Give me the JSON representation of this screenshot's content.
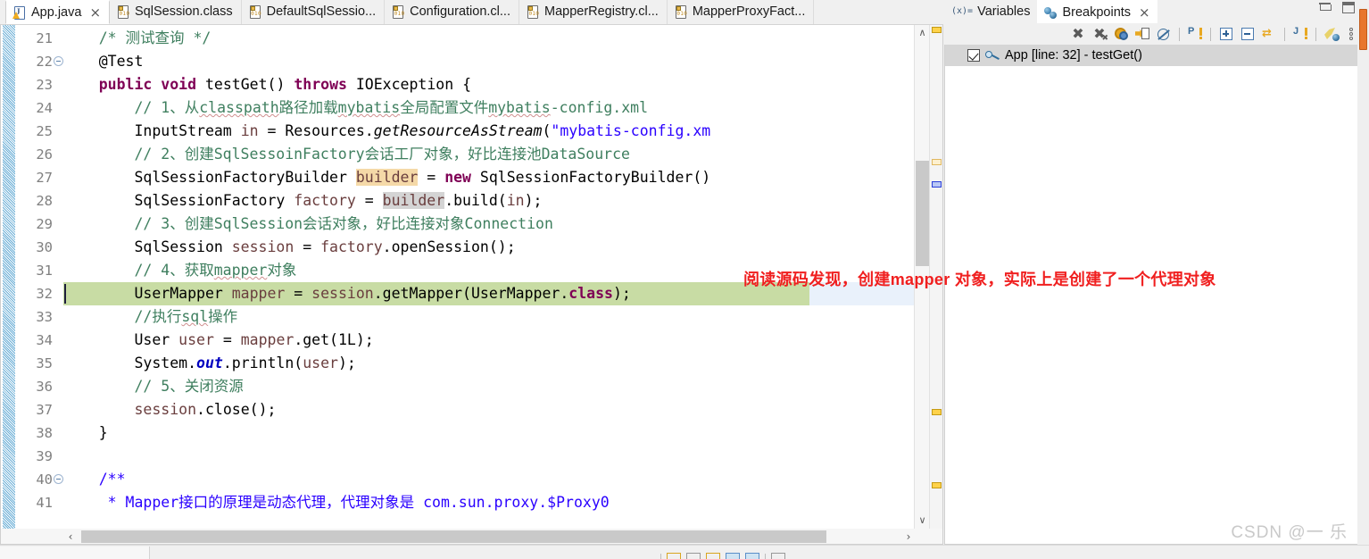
{
  "editor": {
    "tabs": [
      {
        "label": "App.java",
        "icon": "java-file-icon",
        "active": true,
        "closable": true,
        "close_glyph": "×"
      },
      {
        "label": "SqlSession.class",
        "icon": "class-file-icon",
        "active": false,
        "closable": false
      },
      {
        "label": "DefaultSqlSessio...",
        "icon": "class-file-icon",
        "active": false,
        "closable": false
      },
      {
        "label": "Configuration.cl...",
        "icon": "class-file-icon",
        "active": false,
        "closable": false
      },
      {
        "label": "MapperRegistry.cl...",
        "icon": "class-file-icon",
        "active": false,
        "closable": false
      },
      {
        "label": "MapperProxyFact...",
        "icon": "class-file-icon",
        "active": false,
        "closable": false
      }
    ],
    "first_line_number": 21,
    "lines": [
      {
        "n": 21,
        "fold": false,
        "bp": false,
        "html": "<span class=\"cmt\">    /* 测试查询 */</span>"
      },
      {
        "n": 22,
        "fold": true,
        "bp": false,
        "html": "    @Test"
      },
      {
        "n": 23,
        "fold": false,
        "bp": false,
        "html": "    <span class=\"kw\">public</span> <span class=\"kw\">void</span> testGet() <span class=\"kw\">throws</span> IOException {"
      },
      {
        "n": 24,
        "fold": false,
        "bp": false,
        "html": "        <span class=\"cmt\">// 1、从<span class=\"sq\">classpath</span>路径加载<span class=\"sq\">mybatis</span>全局配置文件<span class=\"sq\">mybatis</span>-config.xml</span>"
      },
      {
        "n": 25,
        "fold": false,
        "bp": false,
        "html": "        InputStream <span class=\"lvar\">in</span> = Resources.<span class=\"mth\">getResourceAsStream</span>(<span class=\"str\">\"mybatis-config.xm</span>"
      },
      {
        "n": 26,
        "fold": false,
        "bp": false,
        "html": "        <span class=\"cmt\">// 2、创建SqlSessoinFactory会话工厂对象，好比连接池DataSource</span>"
      },
      {
        "n": 27,
        "fold": false,
        "bp": false,
        "html": "        SqlSessionFactoryBuilder <span class=\"lvar hi-occ-o\">builder</span> = <span class=\"kw\">new</span> SqlSessionFactoryBuilder()"
      },
      {
        "n": 28,
        "fold": false,
        "bp": false,
        "html": "        SqlSessionFactory <span class=\"lvar\">factory</span> = <span class=\"lvar hi-occ-g\">builder</span>.build(<span class=\"lvar\">in</span>);"
      },
      {
        "n": 29,
        "fold": false,
        "bp": false,
        "html": "        <span class=\"cmt\">// 3、创建SqlSession会话对象，好比连接对象Connection</span>"
      },
      {
        "n": 30,
        "fold": false,
        "bp": false,
        "html": "        SqlSession <span class=\"lvar\">session</span> = <span class=\"lvar\">factory</span>.openSession();"
      },
      {
        "n": 31,
        "fold": false,
        "bp": false,
        "html": "        <span class=\"cmt\">// 4、获取<span class=\"sq\">mapper</span>对象</span>"
      },
      {
        "n": 32,
        "fold": false,
        "bp": true,
        "highlight": "current-line",
        "html": "        UserMapper <span class=\"lvar\">mapper</span> = <span class=\"lvar\">session</span>.getMapper(UserMapper.<span class=\"kw\">class</span>);"
      },
      {
        "n": 33,
        "fold": false,
        "bp": false,
        "html": "        <span class=\"cmt\">//执行<span class=\"sq\">sql</span>操作</span>"
      },
      {
        "n": 34,
        "fold": false,
        "bp": false,
        "html": "        User <span class=\"lvar\">user</span> = <span class=\"lvar\">mapper</span>.get(1L);"
      },
      {
        "n": 35,
        "fold": false,
        "bp": false,
        "html": "        System.<span class=\"fld\">out</span>.println(<span class=\"lvar\">user</span>);"
      },
      {
        "n": 36,
        "fold": false,
        "bp": false,
        "html": "        <span class=\"cmt\">// 5、关闭资源</span>"
      },
      {
        "n": 37,
        "fold": false,
        "bp": false,
        "html": "        <span class=\"lvar\">session</span>.close();"
      },
      {
        "n": 38,
        "fold": false,
        "bp": false,
        "html": "    }"
      },
      {
        "n": 39,
        "fold": false,
        "bp": false,
        "html": ""
      },
      {
        "n": 40,
        "fold": true,
        "bp": false,
        "html": "    <span class=\"str\">/**</span>"
      },
      {
        "n": 41,
        "fold": false,
        "bp": false,
        "html": "     <span class=\"str\">* Mapper接口的原理是动态代理，代理对象是 com.sun.proxy.$Proxy0</span>"
      }
    ],
    "scroll": {
      "up_glyph": "∧",
      "down_glyph": "∨",
      "left_glyph": "‹",
      "right_glyph": "›"
    }
  },
  "annotation": {
    "text": "阅读源码发现，创建mapper 对象，实际上是创建了一个代理对象",
    "color": "#f01f1f"
  },
  "right_panel": {
    "tabs": [
      {
        "label": "Variables",
        "icon": "variables-icon",
        "active": false,
        "closable": false
      },
      {
        "label": "Breakpoints",
        "icon": "breakpoints-icon",
        "active": true,
        "closable": true,
        "close_glyph": "×"
      }
    ],
    "toolbar": [
      {
        "name": "remove-breakpoint-button"
      },
      {
        "name": "remove-all-breakpoints-button"
      },
      {
        "name": "breakpoint-properties-button"
      },
      {
        "name": "link-with-debug-view-button"
      },
      {
        "name": "skip-all-breakpoints-button"
      },
      {
        "name": "add-java-exception-breakpoint-button"
      },
      {
        "name": "expand-all-button"
      },
      {
        "name": "collapse-all-button"
      },
      {
        "name": "working-sets-button"
      },
      {
        "name": "add-java-watchpoint-button"
      },
      {
        "name": "pin-breakpoint-button"
      },
      {
        "name": "view-menu-button"
      }
    ],
    "breakpoints": [
      {
        "label": "App [line: 32] - testGet()",
        "checked": true,
        "selected": true
      }
    ]
  },
  "window": {
    "minimize_label": "Minimize",
    "maximize_label": "Maximize"
  },
  "watermark": {
    "text": "CSDN @一 乐"
  }
}
